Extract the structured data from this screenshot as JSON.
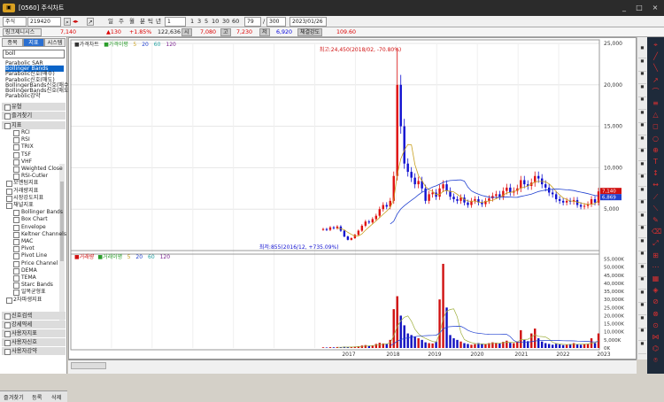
{
  "window": {
    "title": "[0560] 주식차트",
    "minimize": "_",
    "maximize": "□",
    "close": "×"
  },
  "toolbar": {
    "stock_type": "주식",
    "code": "219420",
    "name": "링크제니시스",
    "periods": [
      "일",
      "주",
      "월",
      "분",
      "틱",
      "년"
    ],
    "interval": "1",
    "minutes": [
      "1",
      "3",
      "5",
      "10",
      "30",
      "60"
    ],
    "count": "79",
    "total": "300",
    "date": "2023/01/26"
  },
  "pricebar": {
    "name": "링크제니시스",
    "price": "7,140",
    "change": "▲130",
    "rate": "+1.85%",
    "volume": "122,636",
    "open_label": "시",
    "open": "7,080",
    "high_label": "고",
    "high": "7,230",
    "low_label": "저",
    "low": "6,920",
    "strength_label": "체결강도",
    "strength": "109.60"
  },
  "left": {
    "tabs": [
      "종목",
      "지표",
      "시스템"
    ],
    "search_value": "boll",
    "results": [
      "Parabolic SAR",
      "Bollinger Bands",
      "Parabolic신호(매수)",
      "Parabolic신호(매도)",
      "BollingerBands신호(매수)",
      "BollingerBands신호(매도)",
      "Parabolic강약"
    ],
    "sections": {
      "type": "유형",
      "fav": "즐겨찾기",
      "indicator": "지표"
    },
    "indicators": [
      "RCI",
      "RSI",
      "TRIX",
      "TSF",
      "VHF",
      "Weighted Close",
      "RSI-Cutler"
    ],
    "groups": [
      "모멘텀지표",
      "거래량지표",
      "시장강도지표",
      "채널지표"
    ],
    "channel_items": [
      "Bollinger Bands",
      "Box Chart",
      "Envelope",
      "Keltner Channels",
      "MAC",
      "Pivot",
      "Pivot Line",
      "Price Channel",
      "DEMA",
      "TEMA",
      "Starc Bands",
      "일목균형표"
    ],
    "more_groups": [
      "2차파생지표"
    ],
    "bottom_sections": [
      "신호검색",
      "강세약세",
      "사용자지표",
      "사용자신호",
      "사용자강약"
    ],
    "bottom_tabs": [
      "즐겨찾기",
      "등록",
      "삭제"
    ]
  },
  "chart_data": [
    {
      "type": "candlestick",
      "legend": [
        "가격차트",
        "가격이평",
        "5",
        "20",
        "60",
        "120"
      ],
      "y_ticks": [
        "25,000",
        "20,000",
        "15,000",
        "10,000",
        "5,000"
      ],
      "ylim": [
        0,
        25000
      ],
      "last_price": "7,140",
      "last_ma": "6,869",
      "annotations": {
        "max": "최고:24,450(2018/02,  -70.80%)",
        "min": "최저:855(2016/12,  +735.09%)"
      },
      "series": {
        "close": [
          2600,
          2500,
          2800,
          2700,
          2900,
          2400,
          1700,
          1300,
          1500,
          1900,
          2400,
          3000,
          3500,
          3400,
          3800,
          4200,
          5000,
          5500,
          5300,
          6000,
          9000,
          20000,
          15000,
          10500,
          9500,
          8800,
          8000,
          8400,
          7500,
          6000,
          6800,
          7000,
          6500,
          7500,
          8000,
          7200,
          6500,
          6200,
          6000,
          6400,
          5800,
          5500,
          6000,
          6200,
          5800,
          5600,
          6000,
          6300,
          6600,
          6800,
          6500,
          7200,
          7600,
          7000,
          7200,
          7500,
          8500,
          8000,
          7800,
          8200,
          9000,
          8700,
          8000,
          7600,
          7000,
          6800,
          6200,
          6000,
          5800,
          6000,
          5900,
          6100,
          5500,
          5300,
          5400,
          5600,
          6200,
          5800,
          7140
        ]
      }
    },
    {
      "type": "bar",
      "legend": [
        "거래량",
        "거래이평",
        "5",
        "20",
        "60",
        "120"
      ],
      "y_ticks": [
        "55,000K",
        "50,000K",
        "45,000K",
        "40,000K",
        "35,000K",
        "30,000K",
        "25,000K",
        "20,000K",
        "15,000K",
        "10,000K",
        "5,000K",
        "0K"
      ],
      "ylim": [
        0,
        58000
      ],
      "x_ticks": [
        "2017",
        "2018",
        "2019",
        "2020",
        "2021",
        "2022",
        "2023"
      ],
      "volumes": [
        400,
        300,
        500,
        400,
        600,
        300,
        800,
        600,
        700,
        900,
        1100,
        1500,
        1800,
        1400,
        1600,
        2500,
        3200,
        2800,
        2600,
        5000,
        24000,
        32000,
        20000,
        14000,
        9000,
        8000,
        7000,
        6000,
        5000,
        3500,
        3000,
        2800,
        4000,
        30000,
        52000,
        25000,
        8000,
        6000,
        5000,
        4000,
        3000,
        2500,
        2000,
        2400,
        3000,
        2600,
        2200,
        3000,
        3500,
        3200,
        2800,
        3800,
        4500,
        3200,
        3000,
        4000,
        11000,
        5000,
        4200,
        9000,
        12000,
        6000,
        4000,
        3000,
        2500,
        2000,
        2600,
        2200,
        1800,
        2000,
        2400,
        3000,
        2400,
        2000,
        2200,
        2600,
        6000,
        3000,
        9000
      ]
    }
  ]
}
